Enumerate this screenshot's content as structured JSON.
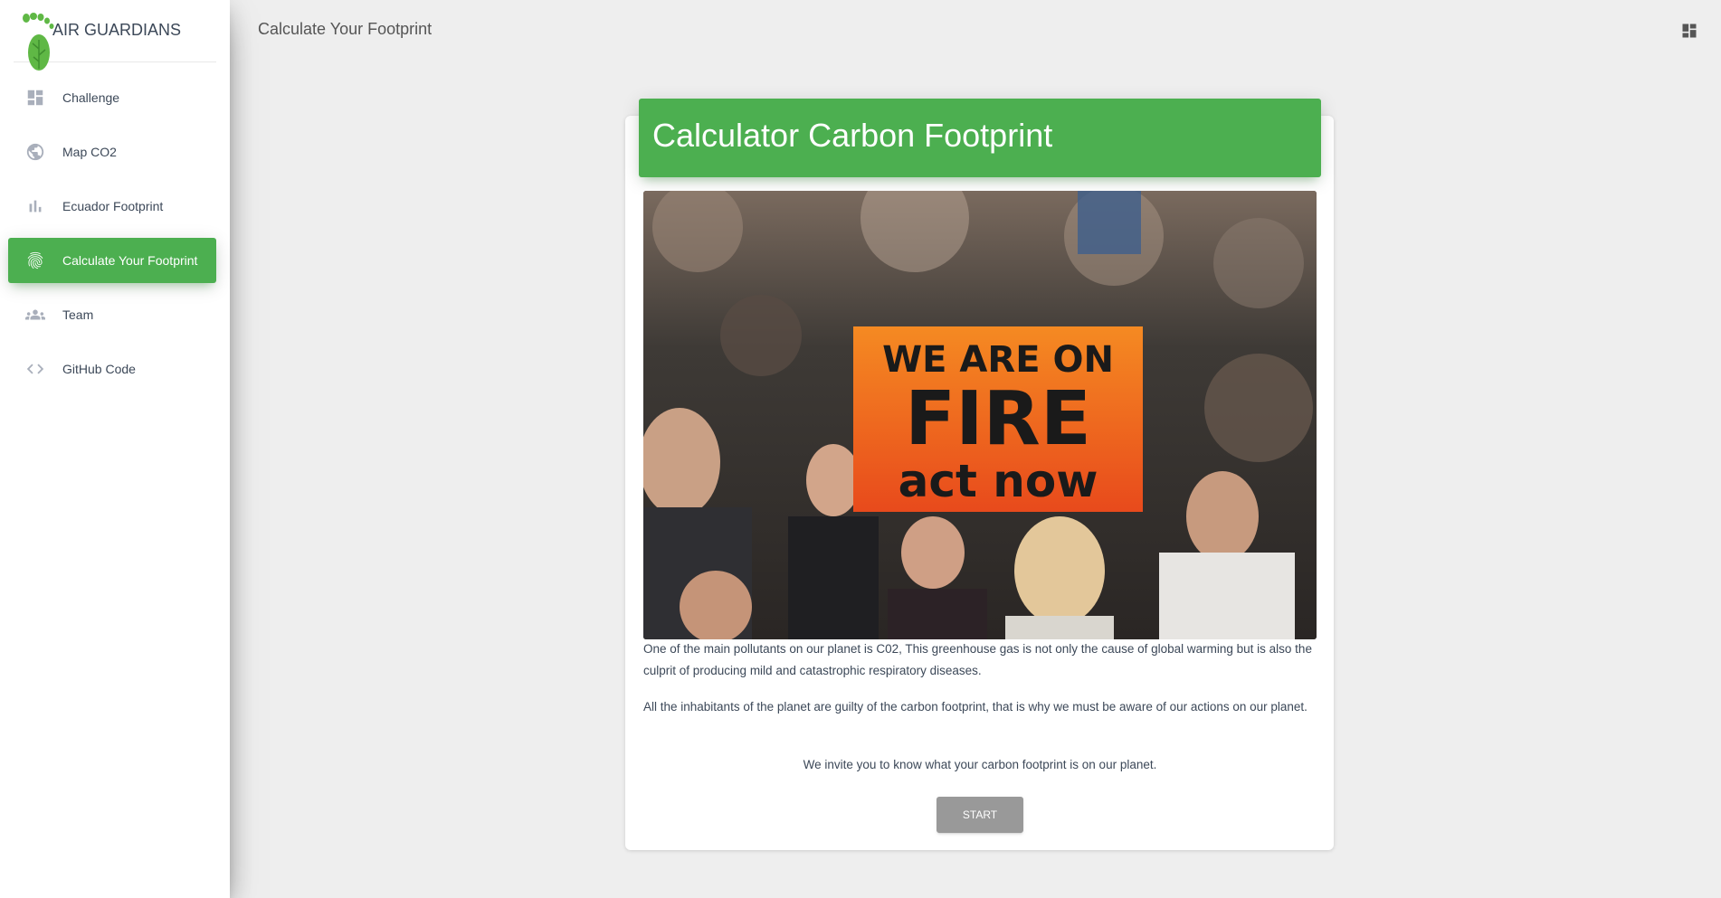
{
  "sidebar": {
    "brand": "AIR GUARDIANS",
    "items": [
      {
        "label": "Challenge",
        "icon": "dashboard-icon",
        "active": false
      },
      {
        "label": "Map CO2",
        "icon": "globe-icon",
        "active": false
      },
      {
        "label": "Ecuador Footprint",
        "icon": "bar-chart-icon",
        "active": false
      },
      {
        "label": "Calculate Your Footprint",
        "icon": "fingerprint-icon",
        "active": true
      },
      {
        "label": "Team",
        "icon": "people-icon",
        "active": false
      },
      {
        "label": "GitHub Code",
        "icon": "code-icon",
        "active": false
      }
    ]
  },
  "topbar": {
    "title": "Calculate Your Footprint",
    "icon": "dashboard-icon"
  },
  "card": {
    "title": "Calculator Carbon Footprint",
    "image": {
      "description": "Crowd of protesters holding orange sign",
      "sign_lines": [
        "WE ARE ON",
        "FIRE",
        "act now"
      ]
    },
    "paragraphs": [
      "One of the main pollutants on our planet is C02, This greenhouse gas is not only the cause of global warming but is also the culprit of producing mild and catastrophic respiratory diseases.",
      "All the inhabitants of the planet are guilty of the carbon footprint, that is why we must be aware of our actions on our planet.",
      "We invite you to know what your carbon footprint is on our planet."
    ],
    "start_button": "START"
  },
  "colors": {
    "accent": "#4caf50",
    "background": "#eeeeee",
    "button": "#999999",
    "sign": "#f26a1b"
  }
}
